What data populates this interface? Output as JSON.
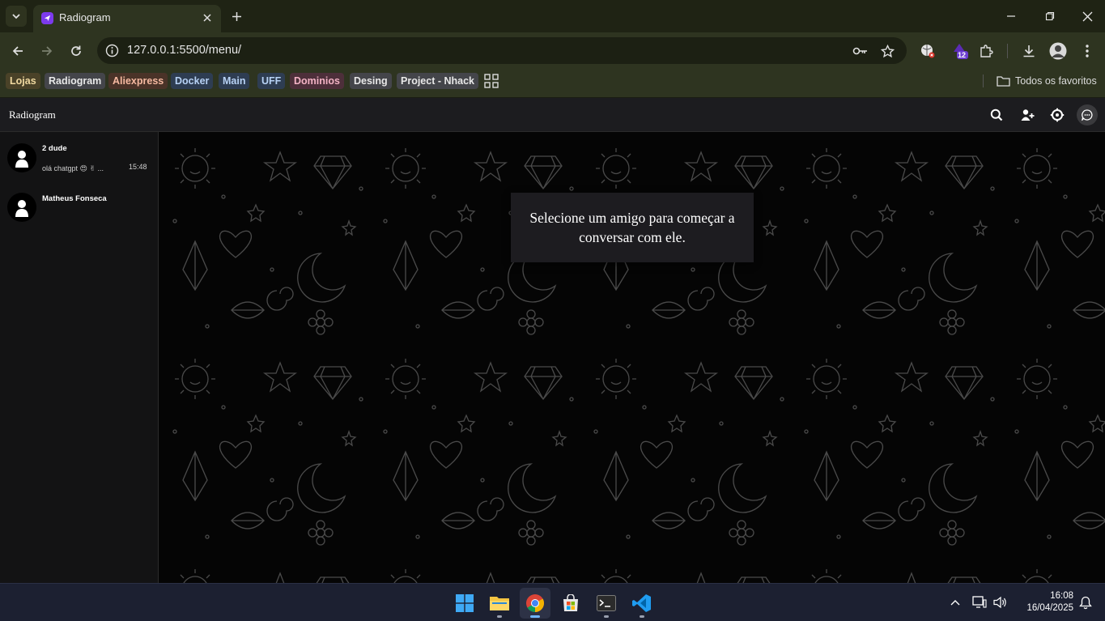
{
  "browser": {
    "tab_title": "Radiogram",
    "url": "127.0.0.1:5500/menu/",
    "extension_badge": "12",
    "bookmarks": [
      {
        "label": "Lojas",
        "bg": "#4a4228",
        "fg": "#f0d9a0"
      },
      {
        "label": "Radiogram",
        "bg": "#44454a",
        "fg": "#e8e8e8"
      },
      {
        "label": "Aliexpress",
        "bg": "#4a3328",
        "fg": "#f5b9a0"
      },
      {
        "label": "Docker",
        "bg": "#2e3d52",
        "fg": "#b7d2f5"
      },
      {
        "label": "Main",
        "bg": "#2e3d52",
        "fg": "#b7d2f5"
      },
      {
        "label": "UFF",
        "bg": "#2e3d52",
        "fg": "#b7d2f5"
      },
      {
        "label": "Dominios",
        "bg": "#4d2f3a",
        "fg": "#f3b3c5"
      },
      {
        "label": "Desing",
        "bg": "#44454a",
        "fg": "#e8e8e8"
      },
      {
        "label": "Project - Nhack",
        "bg": "#44454a",
        "fg": "#e8e8e8"
      }
    ],
    "all_bookmarks_label": "Todos os favoritos"
  },
  "app": {
    "title": "Radiogram",
    "header_icons": [
      "search-icon",
      "add-user-icon",
      "settings-icon",
      "chat-icon"
    ],
    "contacts": [
      {
        "name": "2 dude",
        "last_message": "olá chatgpt 😍 ✌ ...",
        "time": "15:48"
      },
      {
        "name": "Matheus Fonseca",
        "last_message": "",
        "time": ""
      }
    ],
    "empty_state": "Selecione um amigo para começar a conversar com ele."
  },
  "taskbar": {
    "apps": [
      "windows-start-icon",
      "file-explorer-icon",
      "chrome-icon",
      "microsoft-store-icon",
      "terminal-icon",
      "vscode-icon"
    ],
    "time": "16:08",
    "date": "16/04/2025"
  },
  "colors": {
    "accent_purple": "#7c3aed",
    "chrome_frame": "#2e3420",
    "app_background": "#050505"
  }
}
